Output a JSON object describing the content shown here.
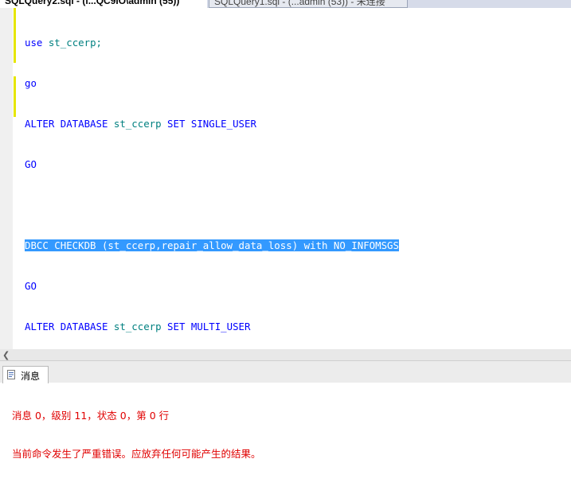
{
  "tabs": {
    "active_label": "SQLQuery2.sql - (l...QC9IO\\admin (55))",
    "inactive_label": "SQLQuery1.sql - (...admin (53)) - 未连接"
  },
  "editor": {
    "line1": {
      "kw": "use",
      "id": " st_ccerp;"
    },
    "line2": {
      "kw": "go"
    },
    "line3": {
      "kw1": "ALTER DATABASE",
      "id": " st_ccerp",
      "kw2": " SET SINGLE_USER"
    },
    "line4": {
      "kw": "GO"
    },
    "line5": "",
    "line6": {
      "selected": "DBCC CHECKDB (st_ccerp,repair_allow_data_loss) with NO_INFOMSGS"
    },
    "line7": {
      "kw": "GO"
    },
    "line8": {
      "kw1": "ALTER DATABASE",
      "id": " st_ccerp",
      "kw2": " SET MULTI_USER"
    }
  },
  "results": {
    "tab_label": "消息",
    "message_line1": "消息 0，级别 11，状态 0，第 0 行",
    "message_line2": "当前命令发生了严重错误。应放弃任何可能产生的结果。"
  },
  "colors": {
    "keyword": "#0000ff",
    "identifier": "#008080",
    "selection": "#3399ff",
    "error_text": "#e00000",
    "change_marker": "#e6e600"
  },
  "icons": {
    "scroll_left": "chevron-left-icon",
    "messages_tab": "message-icon"
  }
}
